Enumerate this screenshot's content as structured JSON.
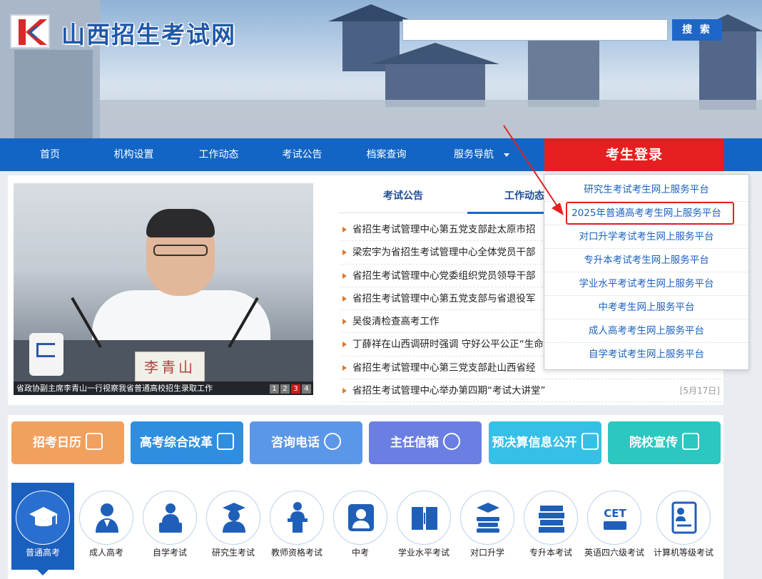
{
  "header": {
    "site_title": "山西招生考试网",
    "search_placeholder": "",
    "search_button": "搜 索"
  },
  "nav": {
    "items": [
      "首页",
      "机构设置",
      "工作动态",
      "考试公告",
      "档案查询",
      "服务导航"
    ],
    "login_button": "考生登录"
  },
  "dropdown": {
    "items": [
      "研究生考试考生网上服务平台",
      "2025年普通高考考生网上服务平台",
      "对口升学考试考生网上服务平台",
      "专升本考试考生网上服务平台",
      "学业水平考试考生网上服务平台",
      "中考考生网上服务平台",
      "成人高考考生网上服务平台",
      "自学考试考生网上服务平台"
    ],
    "highlighted_index": 1
  },
  "slideshow": {
    "caption": "省政协副主席李青山一行视察我省普通高校招生录取工作",
    "nameplate": "李青山",
    "pages": [
      "1",
      "2",
      "3",
      "4"
    ],
    "active_page": "3"
  },
  "news": {
    "tabs": [
      "考试公告",
      "工作动态"
    ],
    "active_tab": "工作动态",
    "items": [
      {
        "title": "省招生考试管理中心第五党支部赴太原市招",
        "date": ""
      },
      {
        "title": "梁宏宇为省招生考试管理中心全体党员干部",
        "date": ""
      },
      {
        "title": "省招生考试管理中心党委组织党员领导干部",
        "date": ""
      },
      {
        "title": "省招生考试管理中心第五党支部与省退役军",
        "date": ""
      },
      {
        "title": "吴俊清检查高考工作",
        "date": ""
      },
      {
        "title": "丁薛祥在山西调研时强调 守好公平公正“生命",
        "date": ""
      },
      {
        "title": "省招生考试管理中心第三党支部赴山西省经",
        "date": ""
      },
      {
        "title": "省招生考试管理中心举办第四期“考试大讲堂”",
        "date": "[5月17日]"
      }
    ]
  },
  "quick_buttons": [
    {
      "label": "招考日历",
      "color": "#f2a05e",
      "icon": "calendar-icon"
    },
    {
      "label": "高考综合改革",
      "color": "#2f8ee0",
      "icon": "share-doc-icon"
    },
    {
      "label": "咨询电话",
      "color": "#5b97e8",
      "icon": "chat-icon"
    },
    {
      "label": "主任信箱",
      "color": "#6b7fe2",
      "icon": "mail-icon"
    },
    {
      "label": "预决算信息公开",
      "color": "#36c0e6",
      "icon": "clipboard-icon"
    },
    {
      "label": "院校宣传",
      "color": "#2cc7c0",
      "icon": "school-icon"
    }
  ],
  "categories": [
    {
      "label": "普通高考",
      "icon": "graduation-cap-icon"
    },
    {
      "label": "成人高考",
      "icon": "adult-student-icon"
    },
    {
      "label": "自学考试",
      "icon": "self-study-icon"
    },
    {
      "label": "研究生考试",
      "icon": "graduate-icon"
    },
    {
      "label": "教师资格考试",
      "icon": "teacher-podium-icon"
    },
    {
      "label": "中考",
      "icon": "student-card-icon"
    },
    {
      "label": "学业水平考试",
      "icon": "book-icon"
    },
    {
      "label": "对口升学",
      "icon": "stacked-books-icon"
    },
    {
      "label": "专升本考试",
      "icon": "books-shelf-icon"
    },
    {
      "label": "英语四六级考试",
      "icon": "cet-icon"
    },
    {
      "label": "计算机等级考试",
      "icon": "certificate-icon"
    }
  ],
  "colors": {
    "nav_blue": "#1265c5",
    "login_red": "#e51f1f",
    "link_blue": "#1d62be",
    "highlight_red": "#e42121"
  }
}
